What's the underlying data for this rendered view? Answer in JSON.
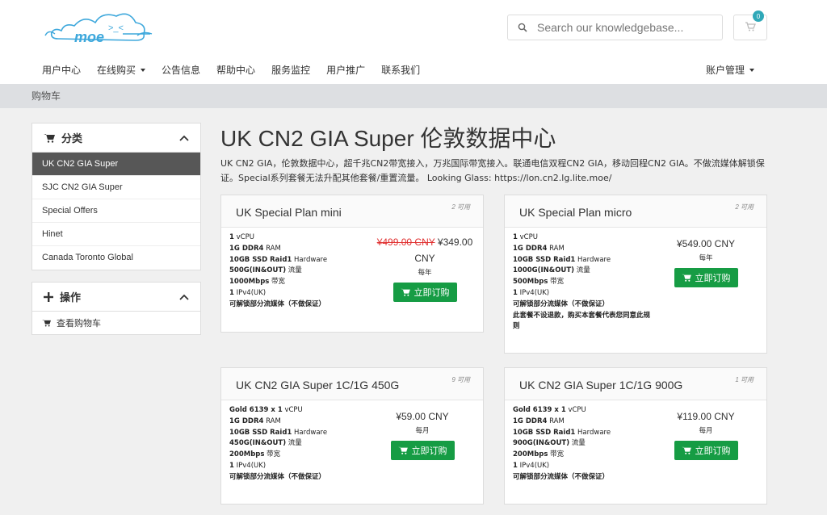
{
  "header": {
    "logo_text": "moe",
    "search_placeholder": "Search our knowledgebase...",
    "cart_count": "0",
    "nav": [
      "用户中心",
      "在线购买",
      "公告信息",
      "帮助中心",
      "服务监控",
      "用户推广",
      "联系我们"
    ],
    "account": "账户管理"
  },
  "breadcrumb": "购物车",
  "sidebar": {
    "category_title": "分类",
    "categories": [
      "UK CN2 GIA Super",
      "SJC CN2 GIA Super",
      "Special Offers",
      "Hinet",
      "Canada Toronto Global"
    ],
    "actions_title": "操作",
    "view_cart": "查看购物车"
  },
  "main": {
    "title": "UK CN2 GIA Super 伦敦数据中心",
    "description": "UK CN2 GIA，伦敦数据中心，超千兆CN2带宽接入，万兆国际带宽接入。联通电信双程CN2 GIA，移动回程CN2 GIA。不做流媒体解锁保证。Special系列套餐无法升配其他套餐/重置流量。 Looking Glass: https://lon.cn2.lg.lite.moe/"
  },
  "products": [
    {
      "name": "UK Special Plan mini",
      "available": "2 可用",
      "features": [
        {
          "b": "1",
          "t": " vCPU"
        },
        {
          "b": "1G DDR4",
          "t": " RAM"
        },
        {
          "b": "10GB SSD Raid1",
          "t": " Hardware"
        },
        {
          "b": "500G(IN&OUT)",
          "t": " 流量"
        },
        {
          "b": "1000Mbps",
          "t": " 带宽"
        },
        {
          "b": "1",
          "t": " IPv4(UK)"
        },
        {
          "b": "可解锁部分流媒体（不做保证）",
          "t": ""
        }
      ],
      "old_price": "¥499.00 CNY",
      "price": "¥349.00 CNY",
      "cycle": "每年",
      "order_label": "立即订购"
    },
    {
      "name": "UK Special Plan micro",
      "available": "2 可用",
      "features": [
        {
          "b": "1",
          "t": " vCPU"
        },
        {
          "b": "1G DDR4",
          "t": " RAM"
        },
        {
          "b": "10GB SSD Raid1",
          "t": " Hardware"
        },
        {
          "b": "1000G(IN&OUT)",
          "t": " 流量"
        },
        {
          "b": "500Mbps",
          "t": " 带宽"
        },
        {
          "b": "1",
          "t": " IPv4(UK)"
        },
        {
          "b": "可解锁部分流媒体（不做保证）",
          "t": ""
        },
        {
          "b": "此套餐不设退款，购买本套餐代表您同意此规则",
          "t": ""
        }
      ],
      "old_price": "",
      "price": "¥549.00 CNY",
      "cycle": "每年",
      "order_label": "立即订购"
    },
    {
      "name": "UK CN2 GIA Super 1C/1G 450G",
      "available": "9 可用",
      "features": [
        {
          "b": "Gold 6139 x 1",
          "t": " vCPU"
        },
        {
          "b": "1G DDR4",
          "t": " RAM"
        },
        {
          "b": "10GB SSD Raid1",
          "t": " Hardware"
        },
        {
          "b": "450G(IN&OUT)",
          "t": " 流量"
        },
        {
          "b": "200Mbps",
          "t": " 带宽"
        },
        {
          "b": "1",
          "t": " IPv4(UK)"
        },
        {
          "b": "可解锁部分流媒体（不做保证）",
          "t": ""
        }
      ],
      "old_price": "",
      "price": "¥59.00 CNY",
      "cycle": "每月",
      "order_label": "立即订购"
    },
    {
      "name": "UK CN2 GIA Super 1C/1G 900G",
      "available": "1 可用",
      "features": [
        {
          "b": "Gold 6139 x 1",
          "t": " vCPU"
        },
        {
          "b": "1G DDR4",
          "t": " RAM"
        },
        {
          "b": "10GB SSD Raid1",
          "t": " Hardware"
        },
        {
          "b": "900G(IN&OUT)",
          "t": " 流量"
        },
        {
          "b": "200Mbps",
          "t": " 带宽"
        },
        {
          "b": "1",
          "t": " IPv4(UK)"
        },
        {
          "b": "可解锁部分流媒体（不做保证）",
          "t": ""
        }
      ],
      "old_price": "",
      "price": "¥119.00 CNY",
      "cycle": "每月",
      "order_label": "立即订购"
    }
  ]
}
